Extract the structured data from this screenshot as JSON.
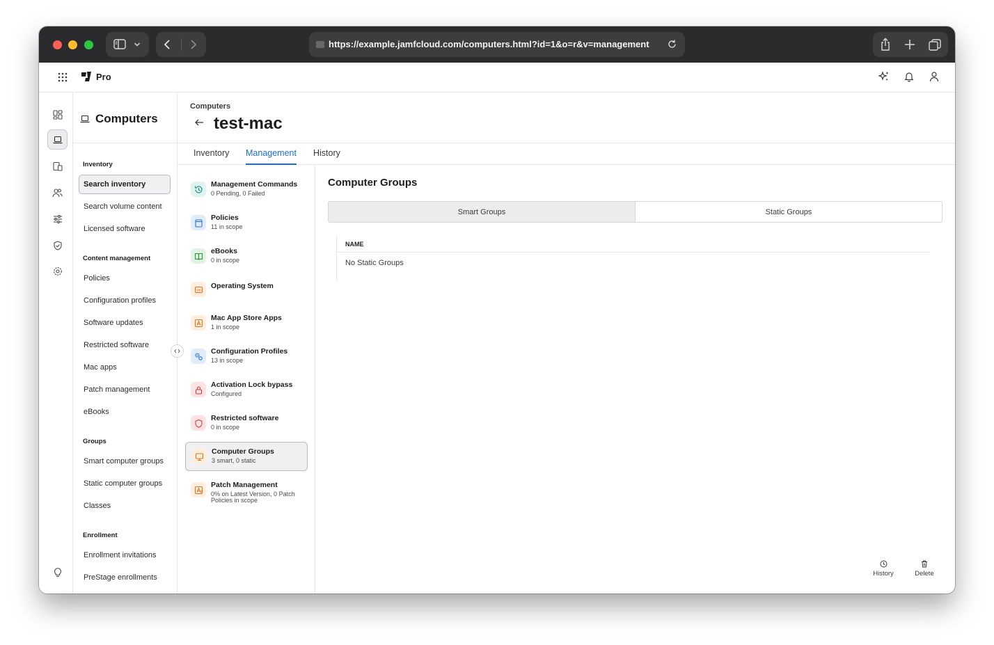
{
  "browser": {
    "url": "https://example.jamfcloud.com/computers.html?id=1&o=r&v=management"
  },
  "app": {
    "product_name": "Pro"
  },
  "secondary_nav": {
    "title": "Computers",
    "sections": [
      {
        "heading": "Inventory",
        "items": [
          "Search inventory",
          "Search volume content",
          "Licensed software"
        ]
      },
      {
        "heading": "Content management",
        "items": [
          "Policies",
          "Configuration profiles",
          "Software updates",
          "Restricted software",
          "Mac apps",
          "Patch management",
          "eBooks"
        ]
      },
      {
        "heading": "Groups",
        "items": [
          "Smart computer groups",
          "Static computer groups",
          "Classes"
        ]
      },
      {
        "heading": "Enrollment",
        "items": [
          "Enrollment invitations",
          "PreStage enrollments"
        ]
      }
    ],
    "active_item": "Search inventory"
  },
  "page": {
    "breadcrumb": "Computers",
    "title": "test-mac",
    "tabs": [
      "Inventory",
      "Management",
      "History"
    ],
    "active_tab": "Management"
  },
  "management_items": [
    {
      "title": "Management Commands",
      "subtitle": "0 Pending, 0 Failed",
      "icon": "history-icon",
      "color": "#0f8a7a",
      "bg": "#dff3ef"
    },
    {
      "title": "Policies",
      "subtitle": "11 in scope",
      "icon": "policies-icon",
      "color": "#2a6fd6",
      "bg": "#e1ecfb"
    },
    {
      "title": "eBooks",
      "subtitle": "0 in scope",
      "icon": "book-icon",
      "color": "#2f8f3a",
      "bg": "#e2f3e3"
    },
    {
      "title": "Operating System",
      "subtitle": "",
      "icon": "os-icon",
      "color": "#d9731c",
      "bg": "#fdeedd"
    },
    {
      "title": "Mac App Store Apps",
      "subtitle": "1 in scope",
      "icon": "app-store-icon",
      "color": "#d9731c",
      "bg": "#fdeedd"
    },
    {
      "title": "Configuration Profiles",
      "subtitle": "13 in scope",
      "icon": "gears-icon",
      "color": "#2a6fd6",
      "bg": "#e1ecfb"
    },
    {
      "title": "Activation Lock bypass",
      "subtitle": "Configured",
      "icon": "lock-icon",
      "color": "#d63a3a",
      "bg": "#fbe3e3"
    },
    {
      "title": "Restricted software",
      "subtitle": "0 in scope",
      "icon": "shield-icon",
      "color": "#d63a3a",
      "bg": "#fbe3e3"
    },
    {
      "title": "Computer Groups",
      "subtitle": "3 smart, 0 static",
      "icon": "monitor-icon",
      "color": "#d9731c",
      "bg": "#fdeedd"
    },
    {
      "title": "Patch Management",
      "subtitle": "0% on Latest Version, 0 Patch Policies in scope",
      "icon": "patch-icon",
      "color": "#d9731c",
      "bg": "#fdeedd"
    }
  ],
  "content": {
    "title": "Computer Groups",
    "segments": [
      "Smart Groups",
      "Static Groups"
    ],
    "selected_segment": "Smart Groups",
    "table_header": "NAME",
    "empty_text": "No Static Groups"
  },
  "footer_actions": [
    "History",
    "Delete"
  ],
  "colors": {
    "accent": "#1a6dd6",
    "chrome": "#2b2b2d"
  }
}
